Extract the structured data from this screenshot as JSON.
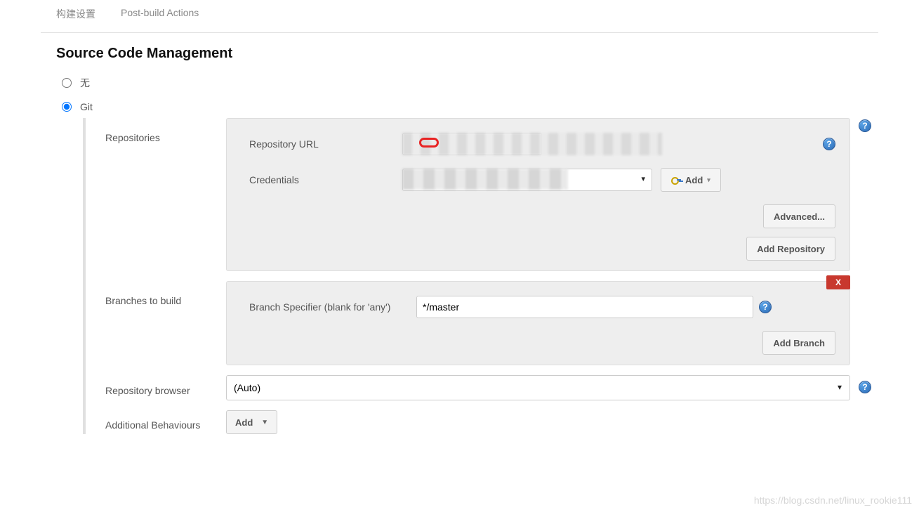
{
  "tabs": {
    "build_settings": "构建设置",
    "post_build": "Post-build Actions"
  },
  "section_title": "Source Code Management",
  "scm": {
    "none_label": "无",
    "git_label": "Git"
  },
  "repositories": {
    "title": "Repositories",
    "url_label": "Repository URL",
    "url_value": "",
    "credentials_label": "Credentials",
    "credentials_value": "",
    "add_button": "Add",
    "advanced_button": "Advanced...",
    "add_repo_button": "Add Repository"
  },
  "branches": {
    "title": "Branches to build",
    "specifier_label": "Branch Specifier (blank for 'any')",
    "specifier_value": "*/master",
    "delete_label": "X",
    "add_branch_button": "Add Branch"
  },
  "repo_browser": {
    "title": "Repository browser",
    "value": "(Auto)"
  },
  "additional": {
    "title": "Additional Behaviours",
    "add_button": "Add"
  },
  "help_glyph": "?",
  "watermark": "https://blog.csdn.net/linux_rookie111"
}
